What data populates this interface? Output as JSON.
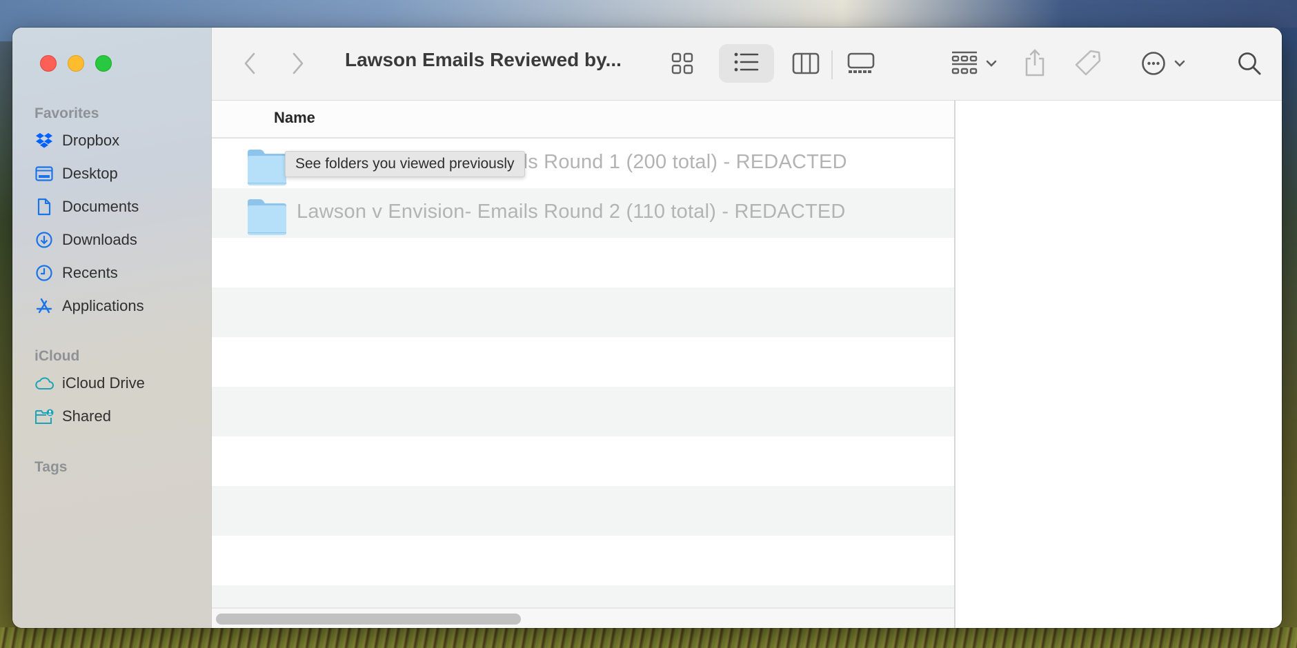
{
  "window": {
    "title": "Lawson Emails Reviewed by...",
    "traffic_lights": [
      "close",
      "minimize",
      "zoom"
    ]
  },
  "toolbar": {
    "back_icon": "chevron-left-icon",
    "forward_icon": "chevron-right-icon",
    "views": [
      {
        "name": "icon-view",
        "icon": "grid-icon",
        "active": false
      },
      {
        "name": "list-view",
        "icon": "list-icon",
        "active": true
      },
      {
        "name": "column-view",
        "icon": "columns-icon",
        "active": false
      },
      {
        "name": "gallery-view",
        "icon": "gallery-icon",
        "active": false
      }
    ],
    "group_icon": "group-by-icon",
    "share_icon": "share-icon",
    "tag_icon": "tag-icon",
    "more_icon": "ellipsis-circle-icon",
    "search_icon": "search-icon"
  },
  "sidebar": {
    "sections": [
      {
        "title": "Favorites",
        "items": [
          {
            "label": "Dropbox",
            "icon": "dropbox-icon"
          },
          {
            "label": "Desktop",
            "icon": "desktop-icon"
          },
          {
            "label": "Documents",
            "icon": "document-icon"
          },
          {
            "label": "Downloads",
            "icon": "download-icon"
          },
          {
            "label": "Recents",
            "icon": "clock-icon"
          },
          {
            "label": "Applications",
            "icon": "applications-icon"
          }
        ]
      },
      {
        "title": "iCloud",
        "items": [
          {
            "label": "iCloud Drive",
            "icon": "cloud-icon"
          },
          {
            "label": "Shared",
            "icon": "shared-folder-icon"
          }
        ]
      },
      {
        "title": "Tags",
        "items": []
      }
    ]
  },
  "list": {
    "column_header": "Name",
    "rows": [
      {
        "name": "Lawson v Envision- Emails Round 1 (200 total) - REDACTED",
        "kind": "folder"
      },
      {
        "name": "Lawson v Envision- Emails Round 2 (110 total) - REDACTED",
        "kind": "folder"
      }
    ]
  },
  "tooltip": {
    "text": "See folders you viewed previously"
  },
  "colors": {
    "accent_blue": "#1a73e8",
    "icloud_teal": "#1ca3b8",
    "folder_blue": "#a9d8f5"
  }
}
